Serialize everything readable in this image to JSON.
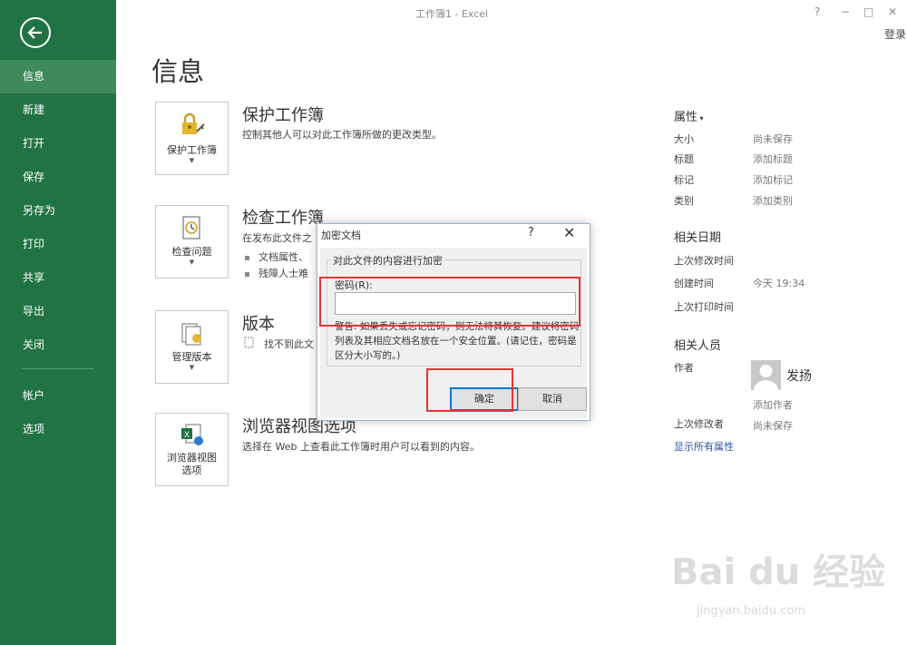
{
  "window": {
    "title": "工作簿1 - Excel",
    "help": "?",
    "minimize": "−",
    "maximize": "□",
    "close": "✕",
    "login": "登录"
  },
  "sidebar": {
    "items": [
      {
        "label": "信息"
      },
      {
        "label": "新建"
      },
      {
        "label": "打开"
      },
      {
        "label": "保存"
      },
      {
        "label": "另存为"
      },
      {
        "label": "打印"
      },
      {
        "label": "共享"
      },
      {
        "label": "导出"
      },
      {
        "label": "关闭"
      }
    ],
    "bottom_items": [
      {
        "label": "帐户"
      },
      {
        "label": "选项"
      }
    ]
  },
  "main": {
    "page_title": "信息",
    "sections": [
      {
        "tile_label": "保护工作簿",
        "title": "保护工作簿",
        "desc": "控制其他人可以对此工作簿所做的更改类型。"
      },
      {
        "tile_label": "检查问题",
        "title": "检查工作簿",
        "desc": "在发布此文件之",
        "bullets": [
          "文档属性、",
          "残障人士难"
        ]
      },
      {
        "tile_label": "管理版本",
        "title": "版本",
        "desc": "找不到此文"
      },
      {
        "tile_label_1": "浏览器视图",
        "tile_label_2": "选项",
        "title": "浏览器视图选项",
        "desc": "选择在 Web 上查看此工作簿时用户可以看到的内容。"
      }
    ]
  },
  "properties": {
    "header": "属性",
    "rows": [
      {
        "key": "大小",
        "value": "尚未保存"
      },
      {
        "key": "标题",
        "value": "添加标题"
      },
      {
        "key": "标记",
        "value": "添加标记"
      },
      {
        "key": "类别",
        "value": "添加类别"
      }
    ],
    "dates_header": "相关日期",
    "dates": [
      {
        "key": "上次修改时间",
        "value": ""
      },
      {
        "key": "创建时间",
        "value": "今天 19:34"
      },
      {
        "key": "上次打印时间",
        "value": ""
      }
    ],
    "people_header": "相关人员",
    "author_key": "作者",
    "author_name": "发扬",
    "add_author": "添加作者",
    "last_modified_by_key": "上次修改者",
    "last_modified_by_value": "尚未保存",
    "show_all": "显示所有属性"
  },
  "dialog": {
    "title": "加密文档",
    "help": "?",
    "close": "✕",
    "group_label": "对此文件的内容进行加密",
    "password_label": "密码(R):",
    "password_value": "",
    "warning": "警告: 如果丢失或忘记密码，则无法将其恢复。建议将密码列表及其相应文档名放在一个安全位置。(请记住，密码是区分大小写的。)",
    "ok_label": "确定",
    "cancel_label": "取消"
  },
  "watermark": {
    "text": "Bai du 经验",
    "sub": "jingyan.baidu.com"
  },
  "colors": {
    "sidebar": "#217346",
    "sidebar_active": "#3e8a5d",
    "highlight": "#e53535",
    "link": "#2b579a"
  }
}
